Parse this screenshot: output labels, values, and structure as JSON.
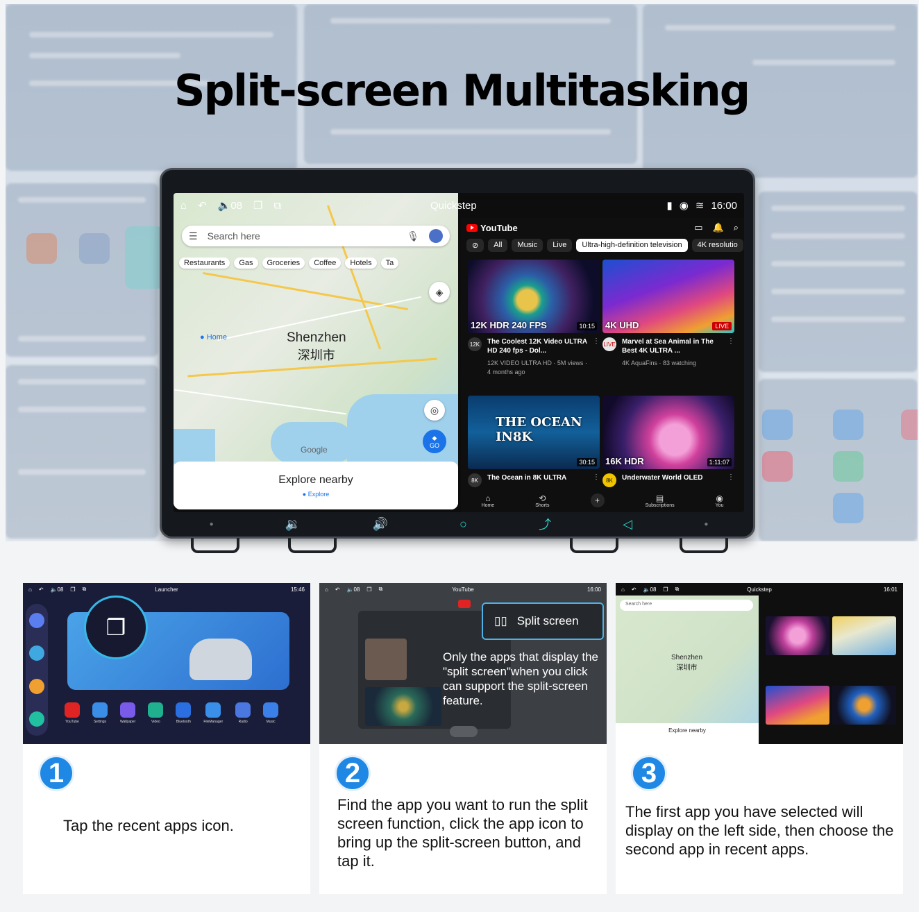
{
  "headline": "Split-screen Multitasking",
  "device": {
    "status": {
      "volume": "08",
      "center_label": "Quickstep",
      "time": "16:00"
    },
    "map_app": {
      "search_placeholder": "Search here",
      "chips": [
        "Restaurants",
        "Gas",
        "Groceries",
        "Coffee",
        "Hotels",
        "Ta"
      ],
      "city_en": "Shenzhen",
      "city_zh": "深圳市",
      "home_label": "Home",
      "go_label": "GO",
      "google_label": "Google",
      "explore_title": "Explore nearby",
      "explore_tab": "Explore"
    },
    "youtube_app": {
      "logo": "YouTube",
      "chips": [
        "All",
        "Music",
        "Live",
        "Ultra-high-definition television",
        "4K resolutio"
      ],
      "videos": [
        {
          "badge": "12K HDR 240 FPS",
          "duration": "10:15",
          "channel": "12K",
          "title": "The Coolest 12K Video ULTRA HD 240 fps - Dol...",
          "meta": "12K VIDEO ULTRA HD · 5M views · 4 months ago"
        },
        {
          "badge": "4K UHD",
          "duration": "LIVE",
          "channel": "LIVE",
          "title": "Marvel at Sea Animal in The Best 4K ULTRA ...",
          "meta": "4K AquaFins · 83 watching"
        },
        {
          "badge": "THE OCEAN IN8K",
          "duration": "30:15",
          "channel": "8K",
          "title": "The Ocean in 8K ULTRA",
          "meta": ""
        },
        {
          "badge": "16K HDR",
          "duration": "1:11:07",
          "channel": "8K",
          "title": "Underwater World OLED",
          "meta": ""
        }
      ],
      "nav": [
        "Home",
        "Shorts",
        "Subscriptions",
        "You"
      ]
    }
  },
  "steps": [
    {
      "number": "1",
      "text": "Tap the recent apps icon.",
      "shot": {
        "center_label": "Launcher",
        "time": "15:46",
        "volume": "08",
        "apps": [
          "YouTube",
          "Settings",
          "Wallpaper",
          "Video",
          "Bluetooth",
          "FileManager",
          "Radio",
          "Music"
        ]
      }
    },
    {
      "number": "2",
      "text": "Find the app you want to run the split screen function, click the app icon to bring up the split-screen button, and tap it.",
      "shot": {
        "center_label": "YouTube",
        "time": "16:00",
        "volume": "08",
        "button": "Split screen",
        "note": "Only the apps that display the \"split screen\"when you click can support the split-screen feature."
      }
    },
    {
      "number": "3",
      "text": "The first app you have selected will display on the left side, then choose the second app in recent apps.",
      "shot": {
        "center_label": "Quickstep",
        "time": "16:01",
        "volume": "08",
        "search": "Search here",
        "city_en": "Shenzhen",
        "city_zh": "深圳市",
        "explore": "Explore nearby"
      }
    }
  ]
}
